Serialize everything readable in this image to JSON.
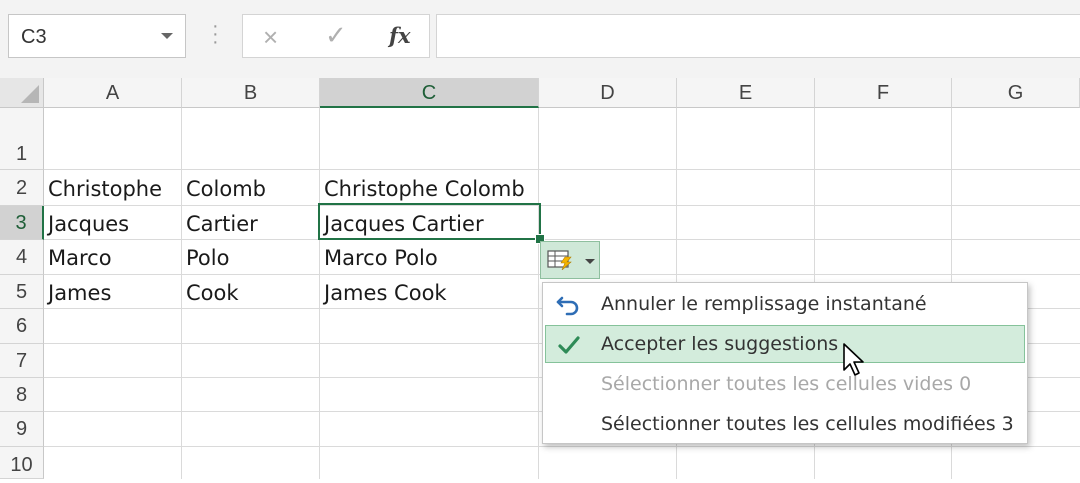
{
  "formula_bar": {
    "name_box": "C3",
    "cancel_icon": "×",
    "enter_icon": "✓",
    "function_icon": "fx",
    "formula_value": ""
  },
  "columns": [
    "A",
    "B",
    "C",
    "D",
    "E",
    "F",
    "G"
  ],
  "rows": [
    "1",
    "2",
    "3",
    "4",
    "5",
    "6",
    "7",
    "8",
    "9",
    "10"
  ],
  "selected_cell": "C3",
  "cells": {
    "A2": "Christophe",
    "B2": "Colomb",
    "C2": "Christophe Colomb",
    "A3": "Jacques",
    "B3": "Cartier",
    "C3": "Jacques Cartier",
    "A4": "Marco",
    "B4": "Polo",
    "C4": "Marco Polo",
    "A5": "James",
    "B5": "Cook",
    "C5": "James Cook"
  },
  "flash_fill_menu": {
    "button_icon": "flash-fill-icon",
    "items": [
      {
        "label": "Annuler le remplissage instantané",
        "icon": "undo-icon",
        "enabled": true,
        "highlighted": false
      },
      {
        "label": "Accepter les suggestions",
        "icon": "check-icon",
        "enabled": true,
        "highlighted": true
      },
      {
        "label": "Sélectionner toutes les cellules vides 0",
        "icon": "",
        "enabled": false,
        "highlighted": false
      },
      {
        "label": "Sélectionner toutes les cellules modifiées 3",
        "icon": "",
        "enabled": true,
        "highlighted": false
      }
    ]
  },
  "colors": {
    "accent_green": "#217346",
    "highlight_bg": "#d3ecdc",
    "undo_blue": "#2e6db5"
  }
}
